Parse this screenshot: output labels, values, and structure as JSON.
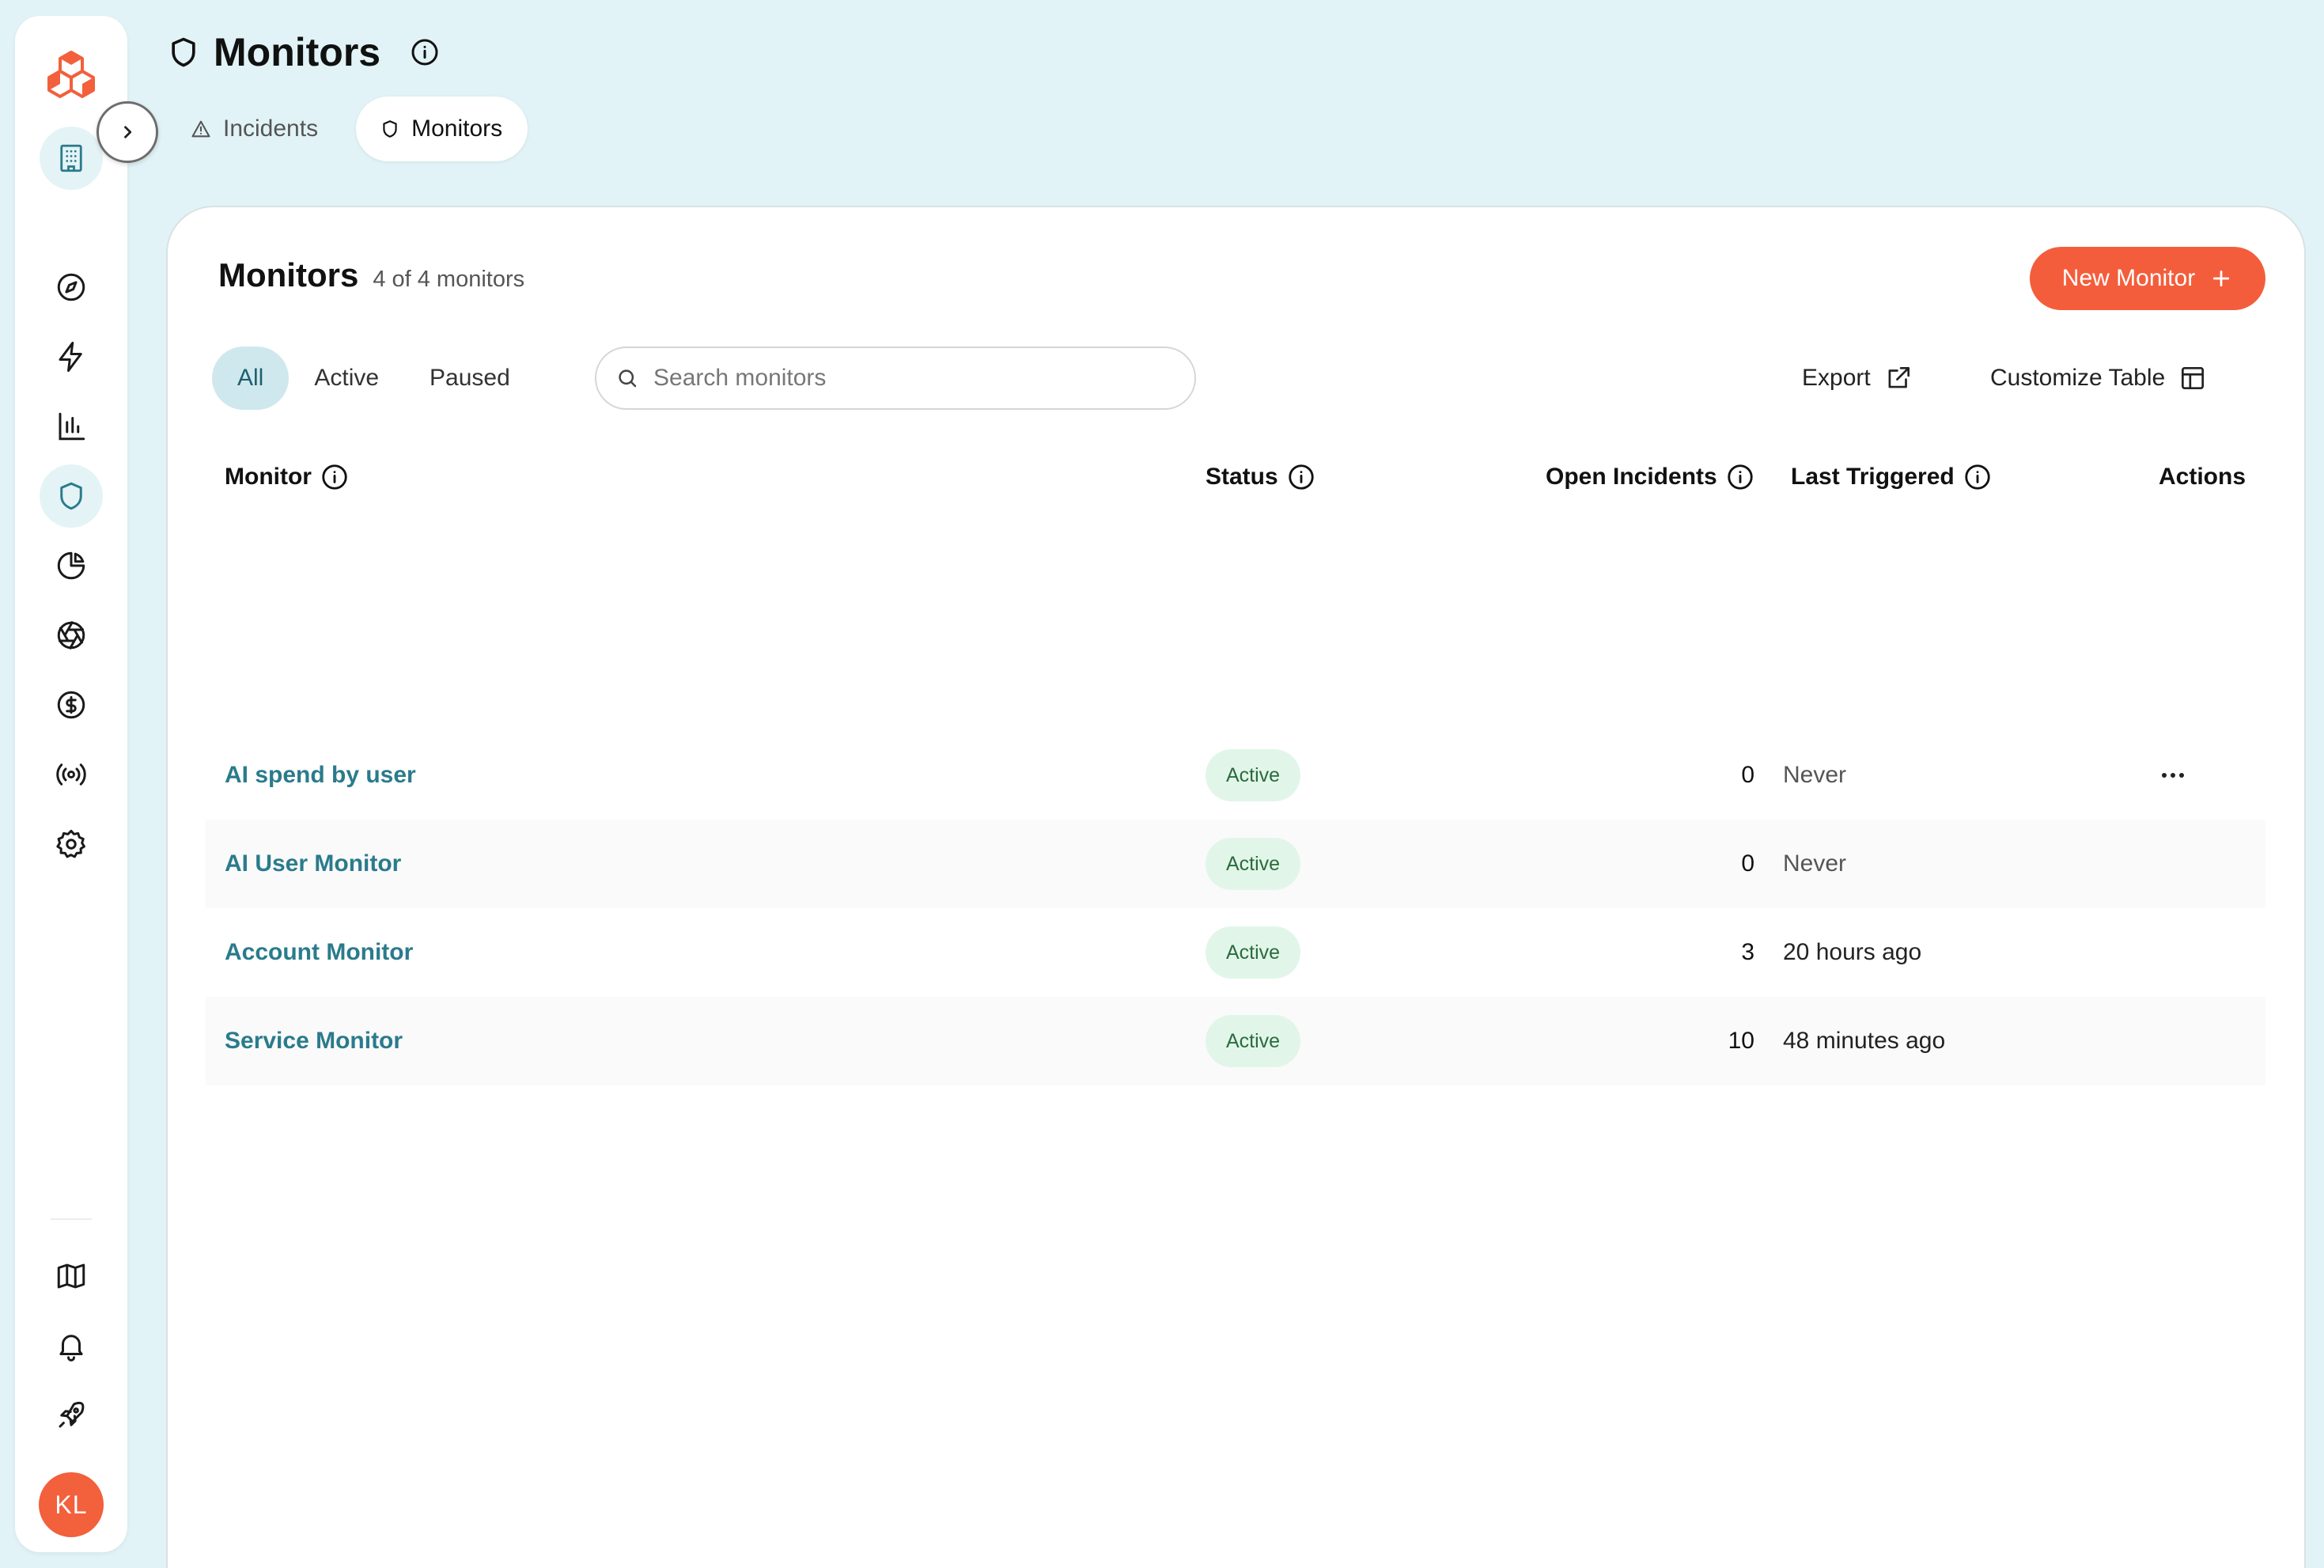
{
  "page": {
    "title": "Monitors",
    "tabs": [
      {
        "label": "Incidents",
        "icon": "warning-triangle-icon",
        "active": false
      },
      {
        "label": "Monitors",
        "icon": "shield-icon",
        "active": true
      }
    ]
  },
  "sidebar": {
    "logo": "hexagon-cluster-logo",
    "workspace_icon": "building-icon",
    "items": [
      {
        "icon": "compass-icon",
        "active": false
      },
      {
        "icon": "lightning-icon",
        "active": false
      },
      {
        "icon": "bar-chart-icon",
        "active": false
      },
      {
        "icon": "shield-icon",
        "active": true
      },
      {
        "icon": "pie-chart-icon",
        "active": false
      },
      {
        "icon": "aperture-icon",
        "active": false
      },
      {
        "icon": "dollar-circle-icon",
        "active": false
      },
      {
        "icon": "broadcast-icon",
        "active": false
      },
      {
        "icon": "gear-icon",
        "active": false
      }
    ],
    "bottom_items": [
      {
        "icon": "map-icon"
      },
      {
        "icon": "bell-icon"
      },
      {
        "icon": "rocket-icon"
      }
    ],
    "avatar_initials": "KL"
  },
  "card": {
    "title": "Monitors",
    "count_text": "4 of 4 monitors",
    "new_button": "New Monitor",
    "filters": [
      "All",
      "Active",
      "Paused"
    ],
    "active_filter": "All",
    "search_placeholder": "Search monitors",
    "export_label": "Export",
    "customize_label": "Customize Table"
  },
  "table": {
    "headers": {
      "monitor": "Monitor",
      "status": "Status",
      "open_incidents": "Open Incidents",
      "last_triggered": "Last Triggered",
      "actions": "Actions"
    },
    "rows": [
      {
        "name": "AI spend by user",
        "status": "Active",
        "open_incidents": "0",
        "last_triggered": "Never"
      },
      {
        "name": "AI User Monitor",
        "status": "Active",
        "open_incidents": "0",
        "last_triggered": "Never"
      },
      {
        "name": "Account Monitor",
        "status": "Active",
        "open_incidents": "3",
        "last_triggered": "20 hours ago"
      },
      {
        "name": "Service Monitor",
        "status": "Active",
        "open_incidents": "10",
        "last_triggered": "48 minutes ago"
      }
    ]
  },
  "colors": {
    "background": "#e1f3f6",
    "accent": "#f45d3b",
    "link": "#2a7b8c",
    "active_badge_bg": "#e1f6e9",
    "active_badge_text": "#2b6b3e"
  }
}
